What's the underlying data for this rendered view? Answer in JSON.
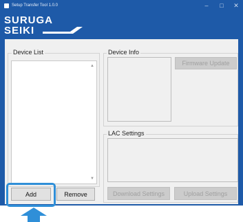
{
  "window": {
    "title": "Setup Transfer Tool 1.0.0",
    "controls": {
      "minimize": "–",
      "maximize": "□",
      "close": "✕"
    },
    "brand": {
      "line1": "SURUGA",
      "line2": "SEIKI"
    },
    "frame_color": "#1e5aa8"
  },
  "device_list": {
    "label": "Device List",
    "items": [],
    "scroll_up_icon": "triangle-up",
    "scroll_down_icon": "triangle-down"
  },
  "device_info": {
    "label": "Device Info",
    "firmware_update_label": "Firmware Update"
  },
  "lac_settings": {
    "label": "LAC Settings",
    "download_label": "Download Settings",
    "upload_label": "Upload Settings"
  },
  "buttons": {
    "add_label": "Add",
    "remove_label": "Remove"
  },
  "annotation": {
    "highlight_color": "#2f8fd8",
    "arrow_icon": "up-arrow-icon"
  }
}
